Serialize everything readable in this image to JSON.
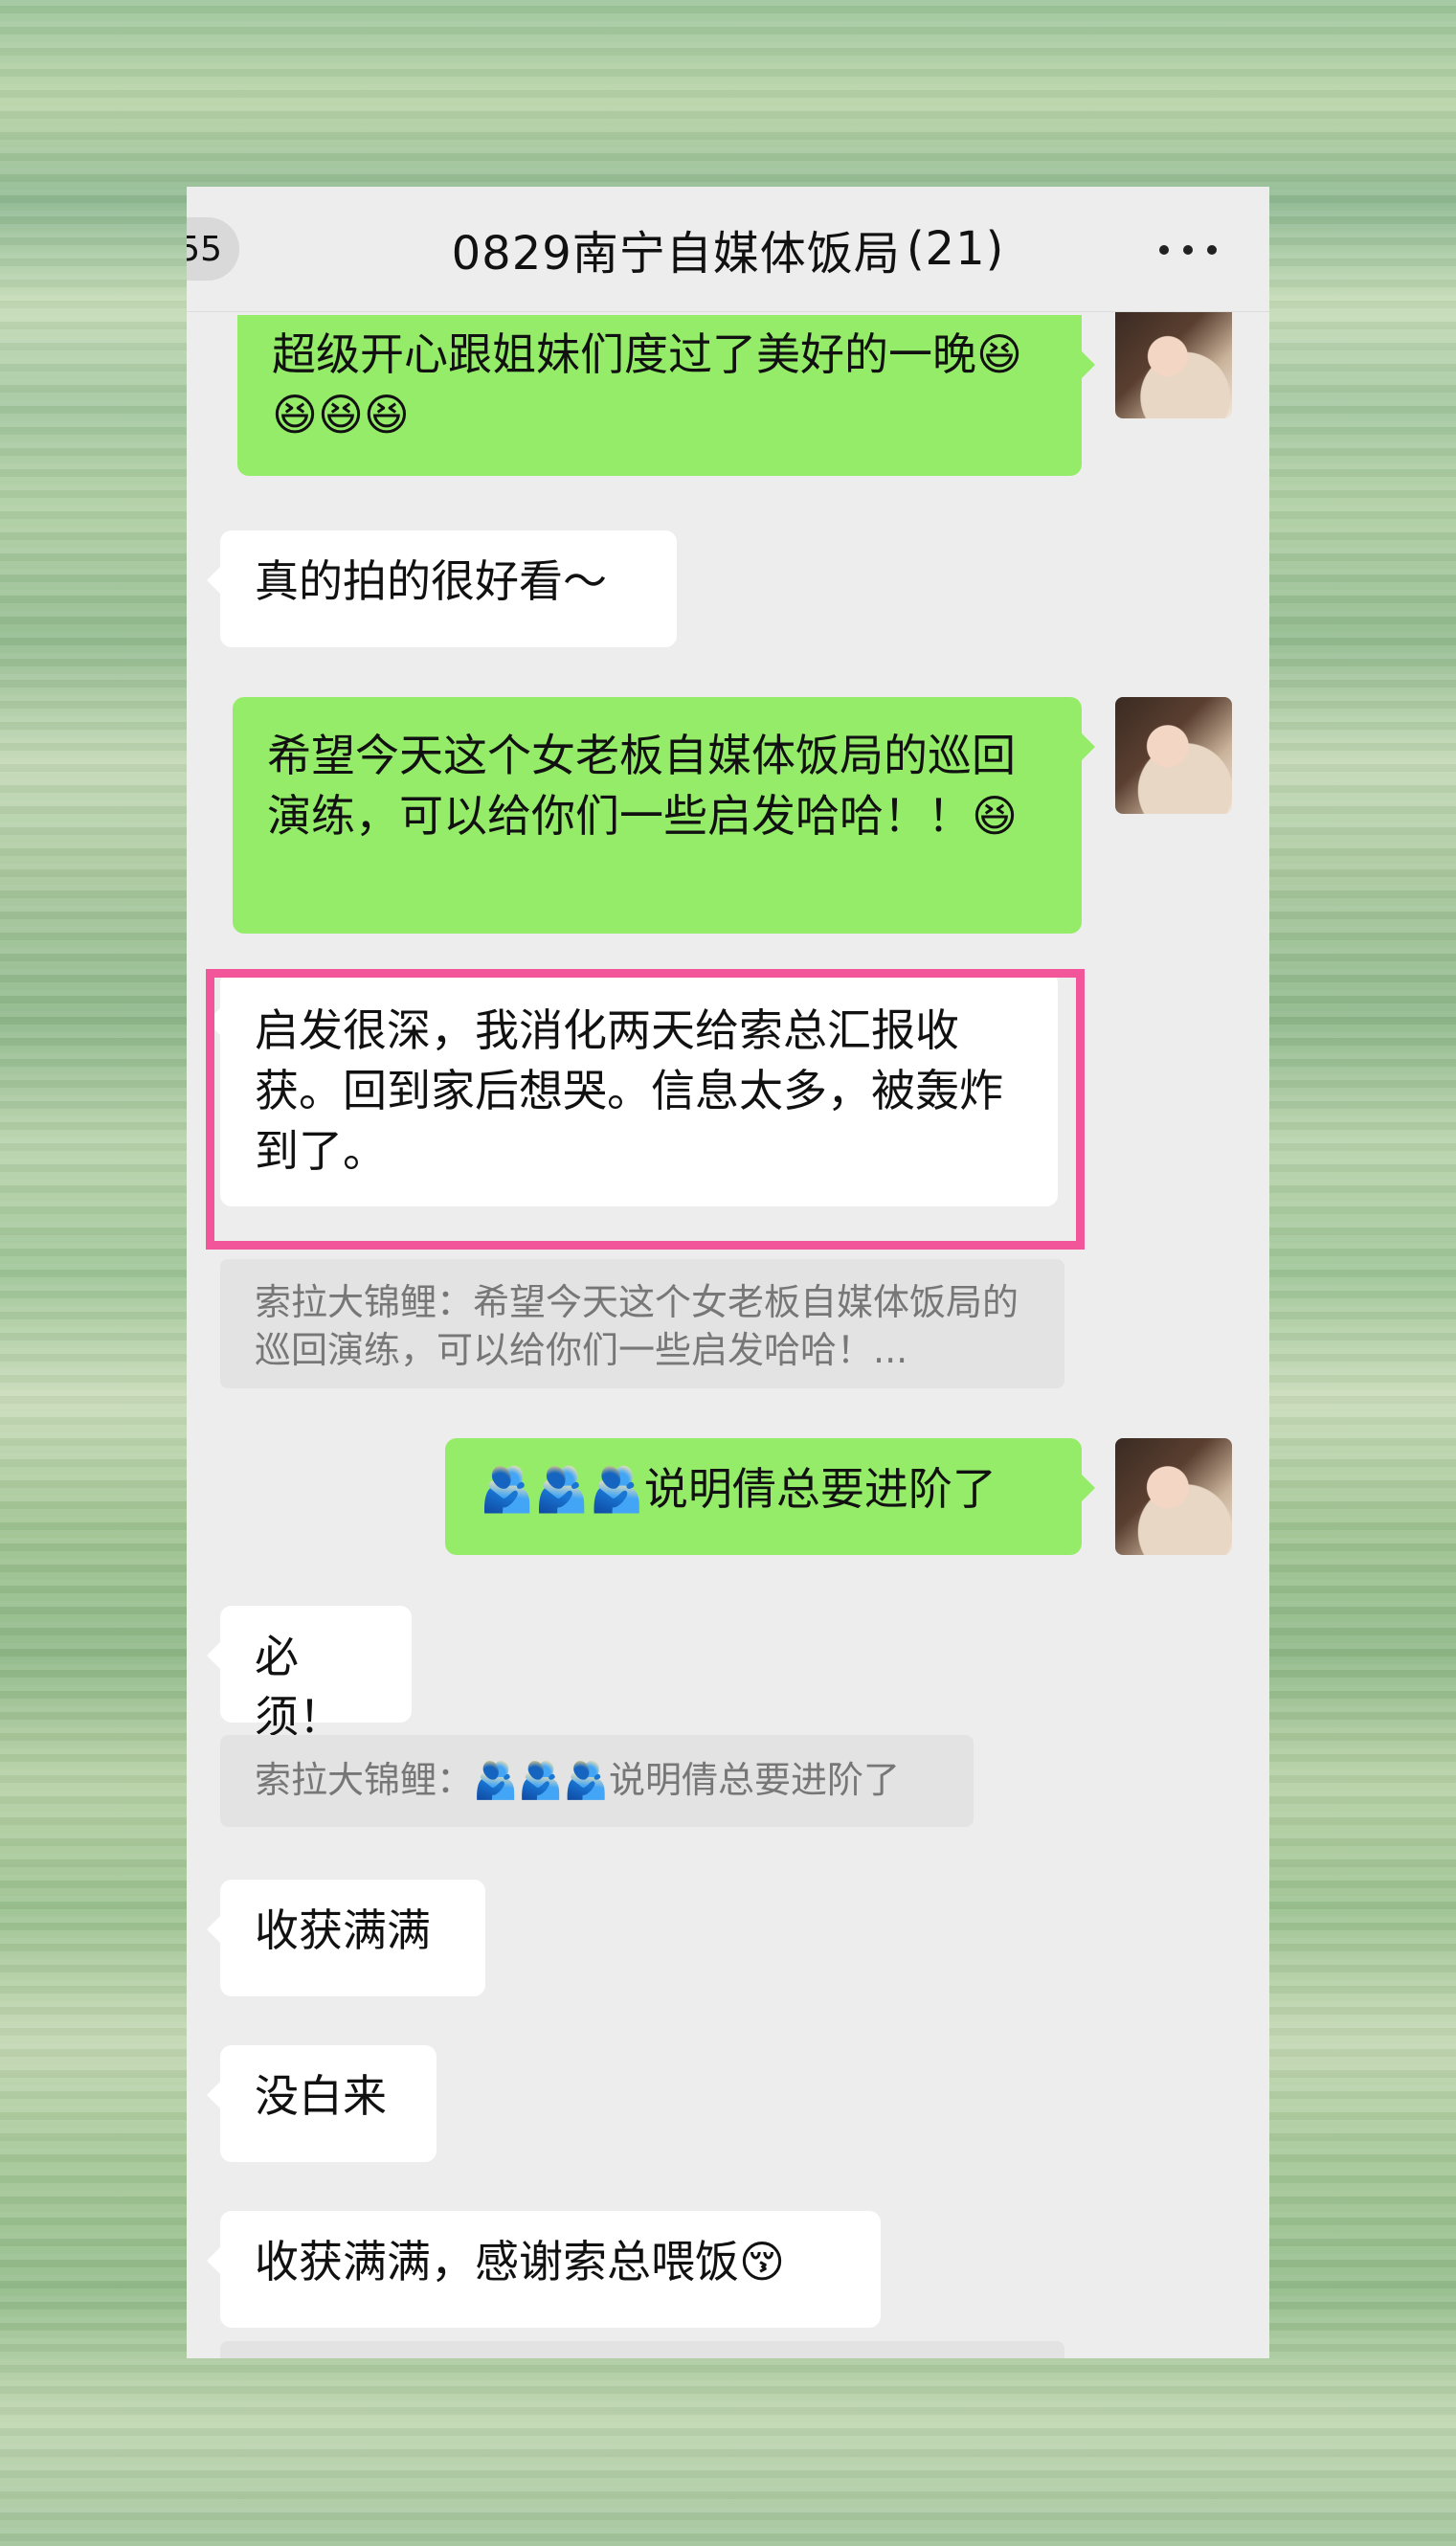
{
  "header": {
    "back_badge": "55",
    "title": "0829南宁自媒体饭局",
    "member_count": "(21)",
    "more_icon": "more-dots-icon"
  },
  "messages": [
    {
      "side": "out",
      "text": "超级开心跟姐妹们度过了美好的一晚😆😆😆😆"
    },
    {
      "side": "in",
      "text": "真的拍的很好看～"
    },
    {
      "side": "out",
      "text": "希望今天这个女老板自媒体饭局的巡回演练，可以给你们一些启发哈哈！！😆"
    },
    {
      "side": "in",
      "text": "启发很深，我消化两天给索总汇报收获。回到家后想哭。信息太多，被轰炸到了。",
      "highlighted": true,
      "quote": "索拉大锦鲤：希望今天这个女老板自媒体饭局的巡回演练，可以给你们一些启发哈哈！..."
    },
    {
      "side": "out",
      "text": "🫂🫂🫂说明倩总要进阶了"
    },
    {
      "side": "in",
      "text": "必须！",
      "quote": "索拉大锦鲤：🫂🫂🫂说明倩总要进阶了"
    },
    {
      "side": "in",
      "text": "收获满满"
    },
    {
      "side": "in",
      "text": "没白来"
    },
    {
      "side": "in",
      "text": "收获满满，感谢索总喂饭😚"
    }
  ],
  "colors": {
    "out_bubble": "#95ec69",
    "in_bubble": "#ffffff",
    "highlight_border": "#f3559a",
    "chat_background": "#ededed"
  }
}
